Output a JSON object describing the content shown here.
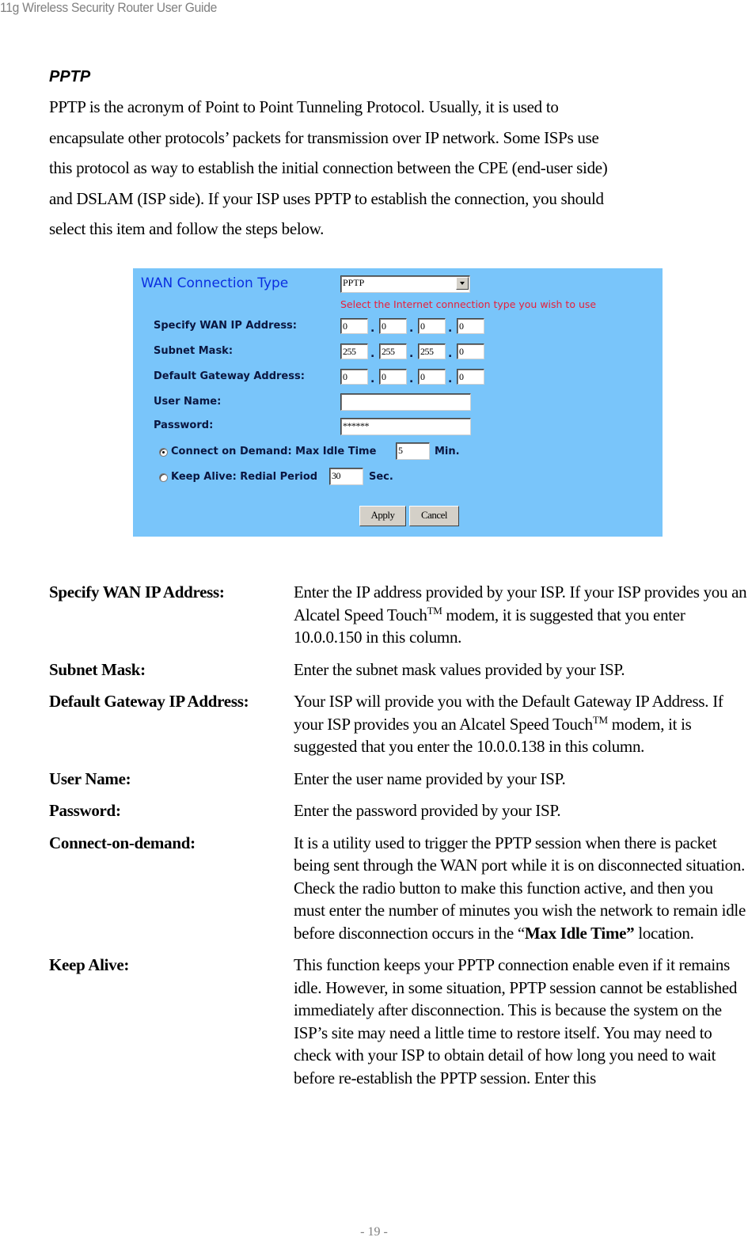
{
  "header": {
    "title": "11g Wireless Security Router User Guide"
  },
  "section": {
    "title": "PPTP",
    "intro_lines": [
      "PPTP is the acronym of Point to Point Tunneling Protocol. Usually, it is used to",
      "encapsulate other protocols’ packets for transmission over IP network. Some ISPs use",
      "this protocol as way to establish the initial connection between the CPE (end-user side)",
      "and DSLAM (ISP side). If your ISP uses PPTP to establish the connection, you should",
      "select this item and follow the steps below."
    ]
  },
  "form": {
    "title": "WAN Connection Type",
    "connection_type": "PPTP",
    "hint": "Select the Internet connection type you wish to use",
    "labels": {
      "wan_ip": "Specify WAN IP Address:",
      "subnet": "Subnet Mask:",
      "gateway": "Default Gateway Address:",
      "username": "User Name:",
      "password": "Password:"
    },
    "wan_ip": [
      "0",
      "0",
      "0",
      "0"
    ],
    "subnet": [
      "255",
      "255",
      "255",
      "0"
    ],
    "gateway": [
      "0",
      "0",
      "0",
      "0"
    ],
    "username": "",
    "password": "******",
    "dot": ".",
    "connect_on_demand": {
      "label": "Connect on Demand: Max Idle Time",
      "value": "5",
      "unit": "Min.",
      "checked": true
    },
    "keep_alive": {
      "label": "Keep Alive: Redial Period",
      "value": "30",
      "unit": "Sec.",
      "checked": false
    },
    "apply_label": "Apply",
    "cancel_label": "Cancel"
  },
  "definitions": [
    {
      "term": "Specify WAN IP Address:",
      "desc_parts": [
        "Enter the IP address provided by your ISP. If your ISP provides you an Alcatel Speed Touch",
        "TM",
        " modem, it is suggested that you enter 10.0.0.150 in this column."
      ]
    },
    {
      "term": "Subnet Mask:",
      "desc": "Enter the subnet mask values provided by your ISP."
    },
    {
      "term": "Default Gateway IP Address:",
      "desc_parts": [
        "Your ISP will provide you with the Default Gateway IP Address. If your ISP provides you an Alcatel Speed Touch",
        "TM",
        " modem, it is suggested that you enter the 10.0.0.138 in this column."
      ]
    },
    {
      "term": "User Name:",
      "desc": "Enter the user name provided by your ISP."
    },
    {
      "term": "Password:",
      "desc": "Enter the password provided by your ISP."
    },
    {
      "term": "Connect-on-demand:",
      "desc_parts": [
        "It is a utility used to trigger the PPTP session when there is packet being sent through the WAN port while it is on disconnected situation. Check the radio button to make this function active, and then you must enter the number of minutes you wish the network to remain idle before disconnection occurs in the “",
        "Max Idle Time”",
        " location."
      ]
    },
    {
      "term": "Keep Alive:",
      "desc": "This function keeps your PPTP connection enable even if it remains idle. However, in some situation, PPTP session cannot be established immediately after disconnection. This is because the system on the ISP’s site may need a little time to restore itself. You may need to check with your ISP to obtain detail of how long you need to wait before re-establish the PPTP session. Enter this"
    }
  ],
  "footer": {
    "page": "- 19 -"
  }
}
